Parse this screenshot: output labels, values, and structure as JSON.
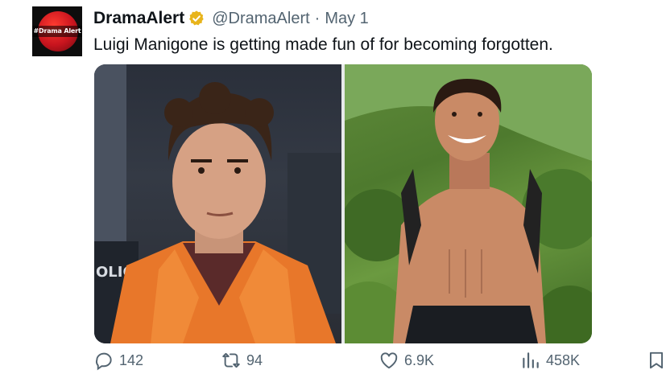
{
  "tweet": {
    "avatar_tag": "#Drama Alert",
    "display_name": "DramaAlert",
    "handle": "@DramaAlert",
    "separator": "·",
    "date": "May 1",
    "text": "Luigi Manigone is getting made fun of for becoming forgotten.",
    "badge_color": "#e8b41b",
    "media": [
      {
        "icon": "photo-prisoner-orange-jumpsuit",
        "sign_text": "OLIC"
      },
      {
        "icon": "photo-hiker-shirtless"
      }
    ]
  },
  "actions": {
    "replies": "142",
    "retweets": "94",
    "likes": "6.9K",
    "views": "458K",
    "icons": [
      "reply-icon",
      "retweet-icon",
      "like-icon",
      "views-icon",
      "bookmark-icon"
    ]
  }
}
